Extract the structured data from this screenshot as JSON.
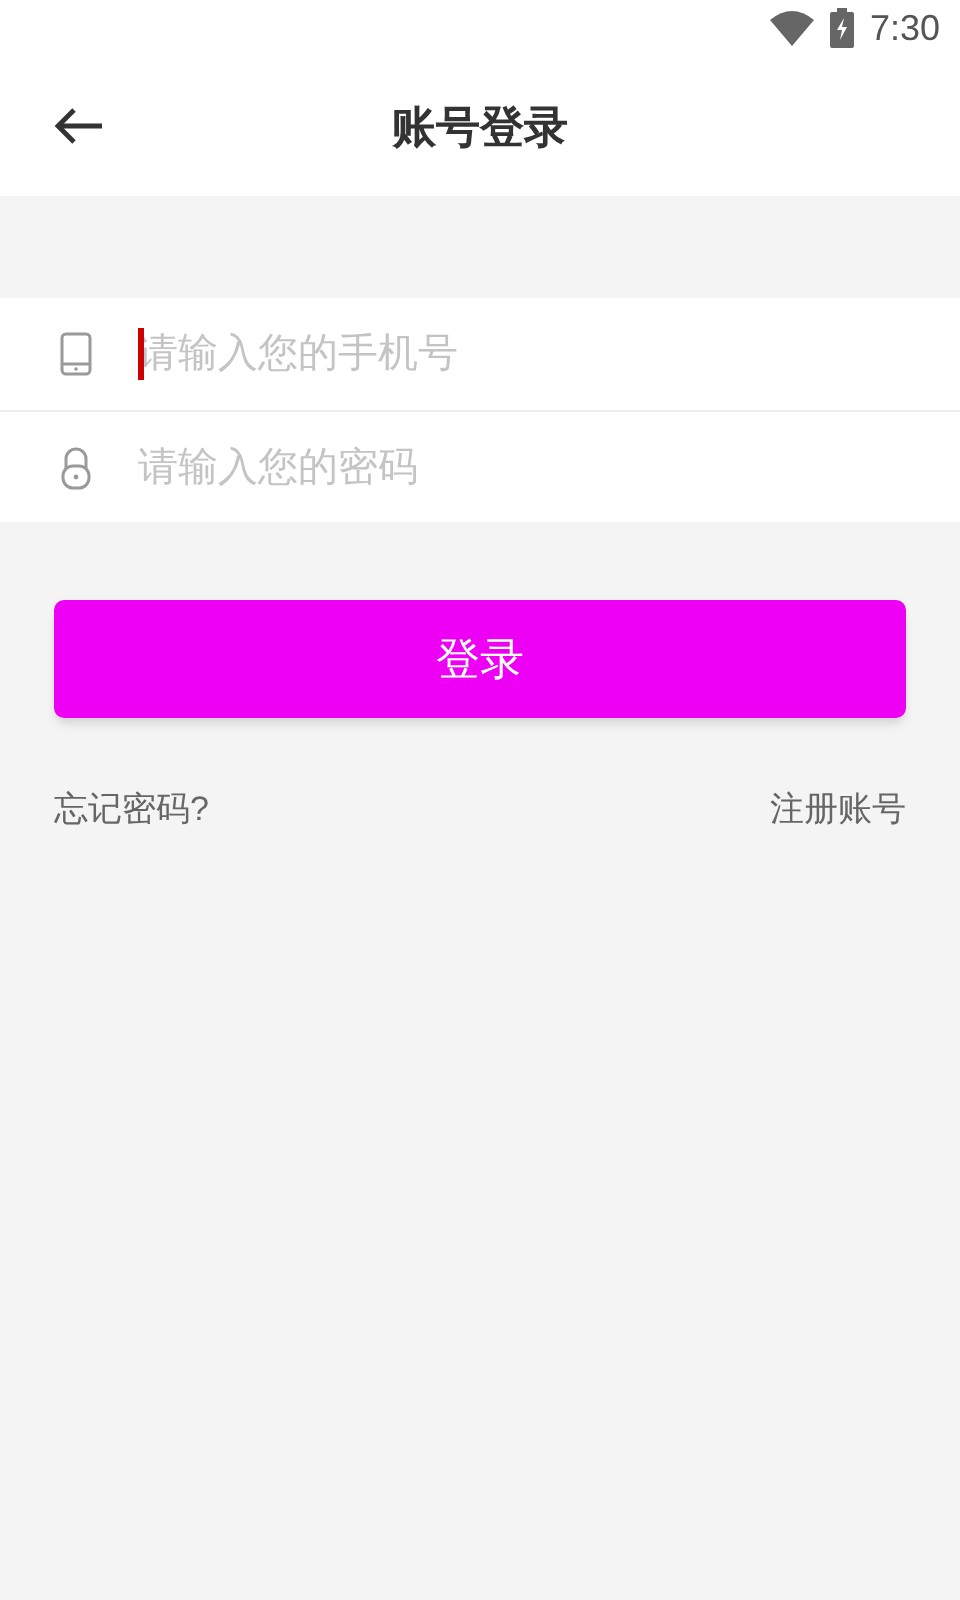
{
  "status_bar": {
    "time": "7:30"
  },
  "header": {
    "title": "账号登录"
  },
  "fields": [
    {
      "kind": "phone",
      "placeholder": "请输入您的手机号",
      "focused": true
    },
    {
      "kind": "lock",
      "placeholder": "请输入您的密码",
      "focused": false
    }
  ],
  "login_button": "登录",
  "links": {
    "forgot": "忘记密码?",
    "register": "注册账号"
  }
}
